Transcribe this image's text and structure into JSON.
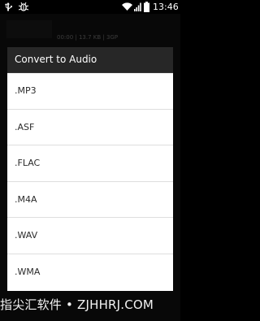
{
  "status_bar": {
    "time": "13:46",
    "icons": [
      "usb-icon",
      "bug-icon",
      "wifi-icon",
      "signal-icon",
      "battery-icon"
    ]
  },
  "background_app": {
    "file_info": "00:00 | 13.7 KB | 3GP"
  },
  "dialog": {
    "title": "Convert to Audio",
    "items": [
      {
        "label": ".MP3"
      },
      {
        "label": ".ASF"
      },
      {
        "label": ".FLAC"
      },
      {
        "label": ".M4A"
      },
      {
        "label": ".WAV"
      },
      {
        "label": ".WMA"
      }
    ]
  },
  "watermark": {
    "text": "指尖汇软件 • ZJHHRJ.COM"
  },
  "colors": {
    "dialog_header": "#272727",
    "dialog_body": "#ffffff",
    "divider": "#dedede",
    "status_bar": "#000000"
  }
}
